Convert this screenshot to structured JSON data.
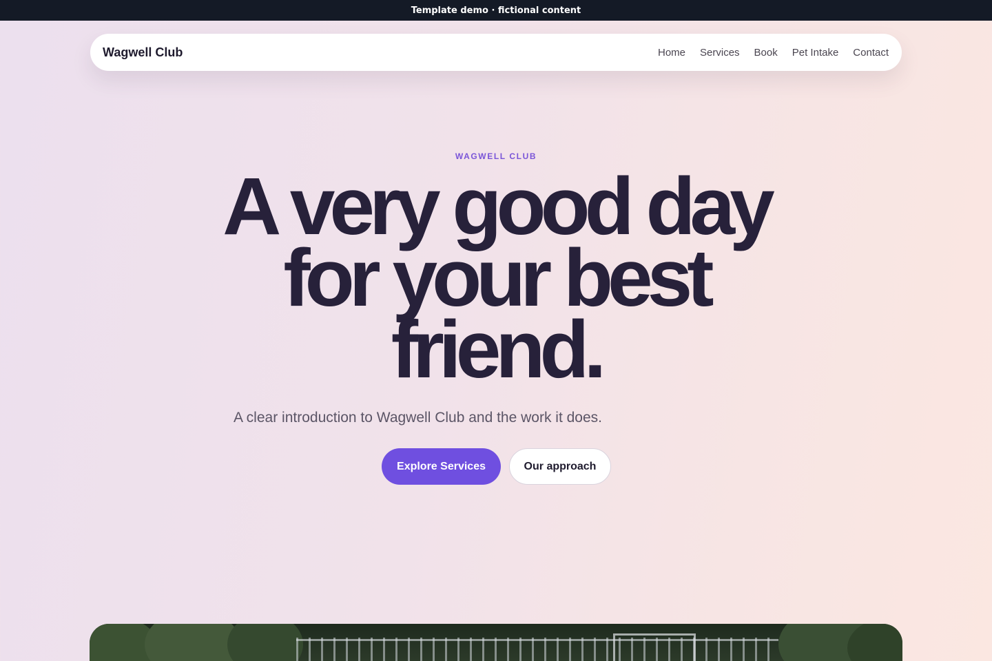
{
  "banner": {
    "text": "Template demo · fictional content"
  },
  "nav": {
    "brand": "Wagwell Club",
    "links": [
      "Home",
      "Services",
      "Book",
      "Pet Intake",
      "Contact"
    ]
  },
  "hero": {
    "eyebrow": "WAGWELL CLUB",
    "headline_lines": [
      "A very good day",
      "for your best",
      "friend."
    ],
    "subtitle": "A clear introduction to Wagwell Club and the work it does.",
    "primary_cta": "Explore Services",
    "secondary_cta": "Our approach"
  },
  "colors": {
    "accent": "#6f4fe0",
    "heading": "#27213a",
    "banner_bg": "#141a26"
  }
}
